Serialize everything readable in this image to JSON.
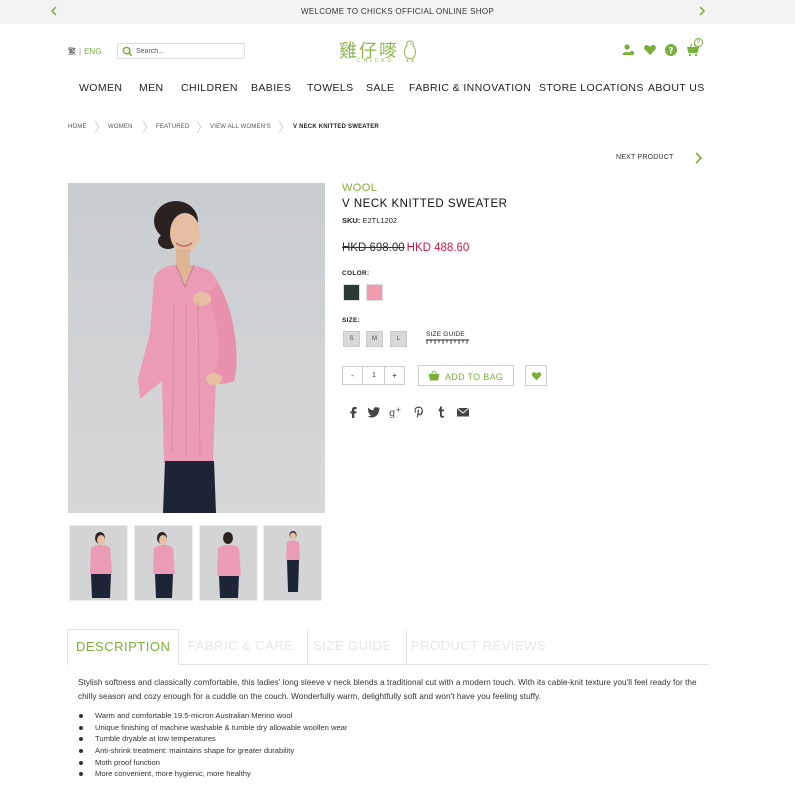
{
  "announcement": {
    "text": "WELCOME TO CHICKS OFFICIAL ONLINE SHOP"
  },
  "header": {
    "lang_zh": "繁",
    "lang_sep": "|",
    "lang_en": "ENG",
    "search_placeholder": "Search...",
    "logo_cn": "雞仔嘜",
    "logo_en": "CHICKS",
    "cart_count": "0",
    "icons": [
      "account-icon",
      "heart-icon",
      "help-icon",
      "cart-icon"
    ]
  },
  "nav": [
    "WOMEN",
    "MEN",
    "CHILDREN",
    "BABIES",
    "TOWELS",
    "SALE",
    "FABRIC & INNOVATION",
    "STORE LOCATIONS",
    "ABOUT US"
  ],
  "breadcrumb": [
    "HOME",
    "WOMEN",
    "FEATURED",
    "VIEW ALL WOMEN'S",
    "V NECK KNITTED SWEATER"
  ],
  "next_product": "NEXT PRODUCT",
  "product": {
    "brand": "WOOL",
    "title": "V NECK KNITTED SWEATER",
    "sku_label": "SKU:",
    "sku_value": "E2TL1202",
    "price_old": "HKD 698.00",
    "price_new": "HKD 488.60",
    "color_label": "COLOR:",
    "colors": [
      "#2b3a33",
      "#f19ab0"
    ],
    "size_label": "SIZE:",
    "sizes": [
      "S",
      "M",
      "L"
    ],
    "size_guide": "SIZE GUIDE",
    "qty_minus": "-",
    "qty_value": "1",
    "qty_plus": "+",
    "add_to_bag": "ADD TO BAG",
    "share_icons": [
      "facebook-icon",
      "twitter-icon",
      "google-plus-icon",
      "pinterest-icon",
      "tumblr-icon",
      "email-icon"
    ]
  },
  "tabs": [
    "DESCRIPTION",
    "FABRIC & CARE",
    "SIZE GUIDE",
    "PRODUCT REVIEWS"
  ],
  "description": {
    "text": "Stylish softness and classically comfortable, this ladies' long sleeve v neck blends a traditional cut with a modern touch. With its cable-knit texture you'll feel ready for the chilly season and cozy enough for a cuddle on the couch. Wonderfully warm, delightfully soft and won't have you feeling stuffy.",
    "bullets": [
      "Warm and comfortable 19.5-micron Australian Merino wool",
      "Unique finishing of machine washable & tumble dry allowable woollen wear",
      "Tumble dryable at low temperatures",
      "Anti-shrink treatment: maintains shape for greater durability",
      "Moth proof function",
      "More convenient, more hygienic, more healthy"
    ]
  },
  "colors": {
    "accent": "#7ab03a",
    "sale": "#d8154d"
  }
}
